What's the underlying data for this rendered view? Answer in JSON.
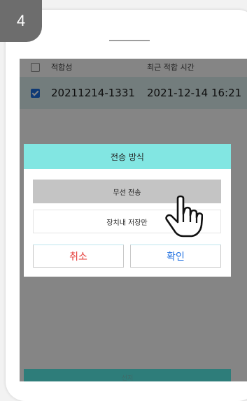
{
  "step": {
    "number": "4"
  },
  "list": {
    "header": {
      "col1": "적합성",
      "col2": "최근 적합 시간"
    },
    "rows": [
      {
        "id": "20211214-1331",
        "time": "2021-12-14 16:21",
        "checked": true
      }
    ]
  },
  "dialog": {
    "title": "전송 방식",
    "options": [
      {
        "label": "무선 전송",
        "highlighted": true
      },
      {
        "label": "장치내 저장만",
        "highlighted": false
      }
    ],
    "cancel_label": "취소",
    "ok_label": "확인"
  },
  "bottom_button": {
    "label": "선저"
  },
  "colors": {
    "dialog_title_bg": "#82e6e2",
    "cancel_text": "#e53935",
    "ok_text": "#1e6fe0",
    "selected_row_bg": "#dcefef",
    "bottom_bar": "#2e7d7a"
  },
  "icons": {
    "pointer": "hand-pointer-icon"
  }
}
